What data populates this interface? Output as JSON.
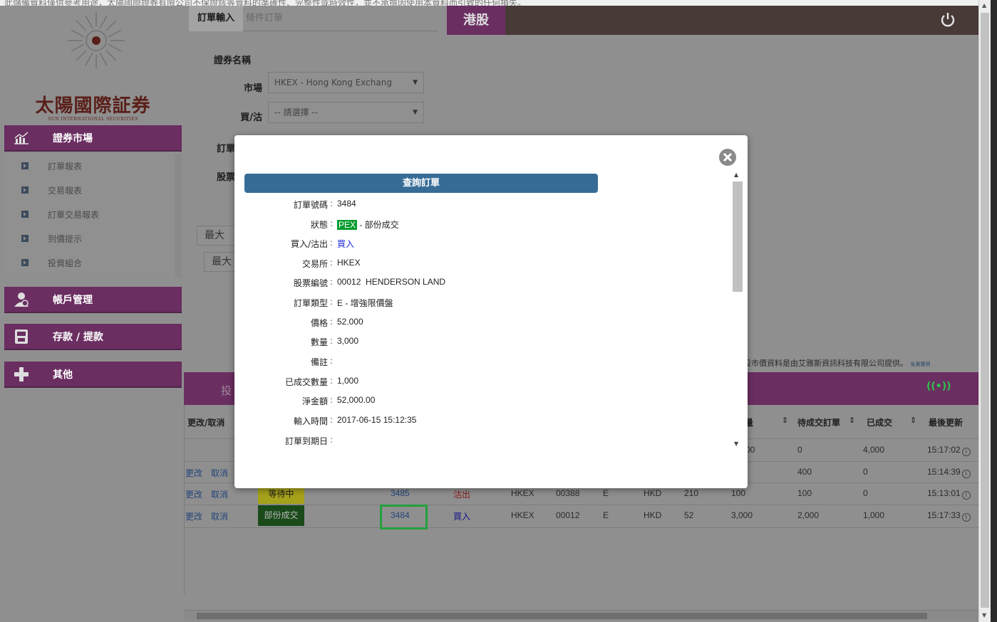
{
  "top_strip": "此儲備資料僅供參考用途，太陽國際證券有限公司不保證該等資料的準確性、完整性或時效性，並不承擔因使用本資料而引致的任何損失。",
  "sidebar": {
    "logo_cn": "太陽國際証券",
    "logo_en": "SUN INTERNATIONAL SECURITIES",
    "sections": [
      {
        "label": "證券市場",
        "icon": "chart-icon"
      },
      {
        "label": "帳戶管理",
        "icon": "account-icon"
      },
      {
        "label": "存款 / 提款",
        "icon": "atm-icon"
      },
      {
        "label": "其他",
        "icon": "plus-icon"
      }
    ],
    "submenu": [
      "訂單報表",
      "交易報表",
      "訂單交易報表",
      "到價提示",
      "投資組合"
    ]
  },
  "tabs": {
    "active": "訂單輸入",
    "inactive": "條件訂單"
  },
  "market_header": "港股",
  "form": {
    "security_name_label": "證券名稱",
    "market_label": "市場",
    "market_value": "HKEX - Hong Kong Exchang",
    "side_label": "買/沽",
    "side_value": "-- 請選擇 --",
    "order_label": "訂單",
    "stock_label": "股票",
    "max1": "最大",
    "max2": "最大"
  },
  "disclaimer": "股市價資料是由艾雅斯資訊科技有限公司提供。",
  "disclaimer_link": "免責聲明",
  "table": {
    "bar_label": "投",
    "headers": {
      "action": "更改/取消",
      "qty": "量",
      "pending": "待成交訂單",
      "executed": "已成交",
      "updated": "最後更新"
    },
    "rows": [
      {
        "action1": "",
        "action2": "",
        "status": "",
        "order_no": "",
        "side": "",
        "exchange": "",
        "code": "",
        "type": "",
        "currency": "",
        "price": "",
        "qty": "00",
        "pending": "0",
        "executed": "4,000",
        "time": "15:17:02"
      },
      {
        "action1": "更改",
        "action2": "取消",
        "status": "",
        "order_no": "",
        "side": "",
        "exchange": "",
        "code": "",
        "type": "",
        "currency": "",
        "price": "",
        "qty": "",
        "pending": "400",
        "executed": "0",
        "time": "15:14:39"
      },
      {
        "action1": "更改",
        "action2": "取消",
        "status": "等待中",
        "order_no": "3485",
        "side": "沽出",
        "exchange": "HKEX",
        "code": "00388",
        "type": "E",
        "currency": "HKD",
        "price": "210",
        "qty": "100",
        "pending": "100",
        "executed": "0",
        "time": "15:13:01"
      },
      {
        "action1": "更改",
        "action2": "取消",
        "status": "部份成交",
        "order_no": "3484",
        "side": "買入",
        "exchange": "HKEX",
        "code": "00012",
        "type": "E",
        "currency": "HKD",
        "price": "52",
        "qty": "3,000",
        "pending": "2,000",
        "executed": "1,000",
        "time": "15:17:33"
      }
    ],
    "info_icon": "i"
  },
  "modal": {
    "title": "查詢訂單",
    "fields": [
      {
        "label": "訂單號碼",
        "value": "3484"
      },
      {
        "label": "狀態",
        "badge": "PEX",
        "value": " - 部份成交"
      },
      {
        "label": "買入/沽出",
        "value": "買入"
      },
      {
        "label": "交易所",
        "value": "HKEX"
      },
      {
        "label": "股票編號",
        "value": "00012  HENDERSON LAND"
      },
      {
        "label": "訂單類型",
        "value": "E - 增強限價盤"
      },
      {
        "label": "價格",
        "value": "52.000"
      },
      {
        "label": "數量",
        "value": "3,000"
      },
      {
        "label": "備註",
        "value": ""
      },
      {
        "label": "已成交數量",
        "value": "1,000"
      },
      {
        "label": "淨金額",
        "value": "52,000.00"
      },
      {
        "label": "輸入時間",
        "value": "2017-06-15 15:12:35"
      },
      {
        "label": "訂單到期日",
        "value": ""
      }
    ]
  },
  "colors": {
    "brand_purple": "#6a2e61",
    "modal_title": "#376c97",
    "pex_green": "#0a9d2e",
    "highlight_green": "#23a03e"
  }
}
